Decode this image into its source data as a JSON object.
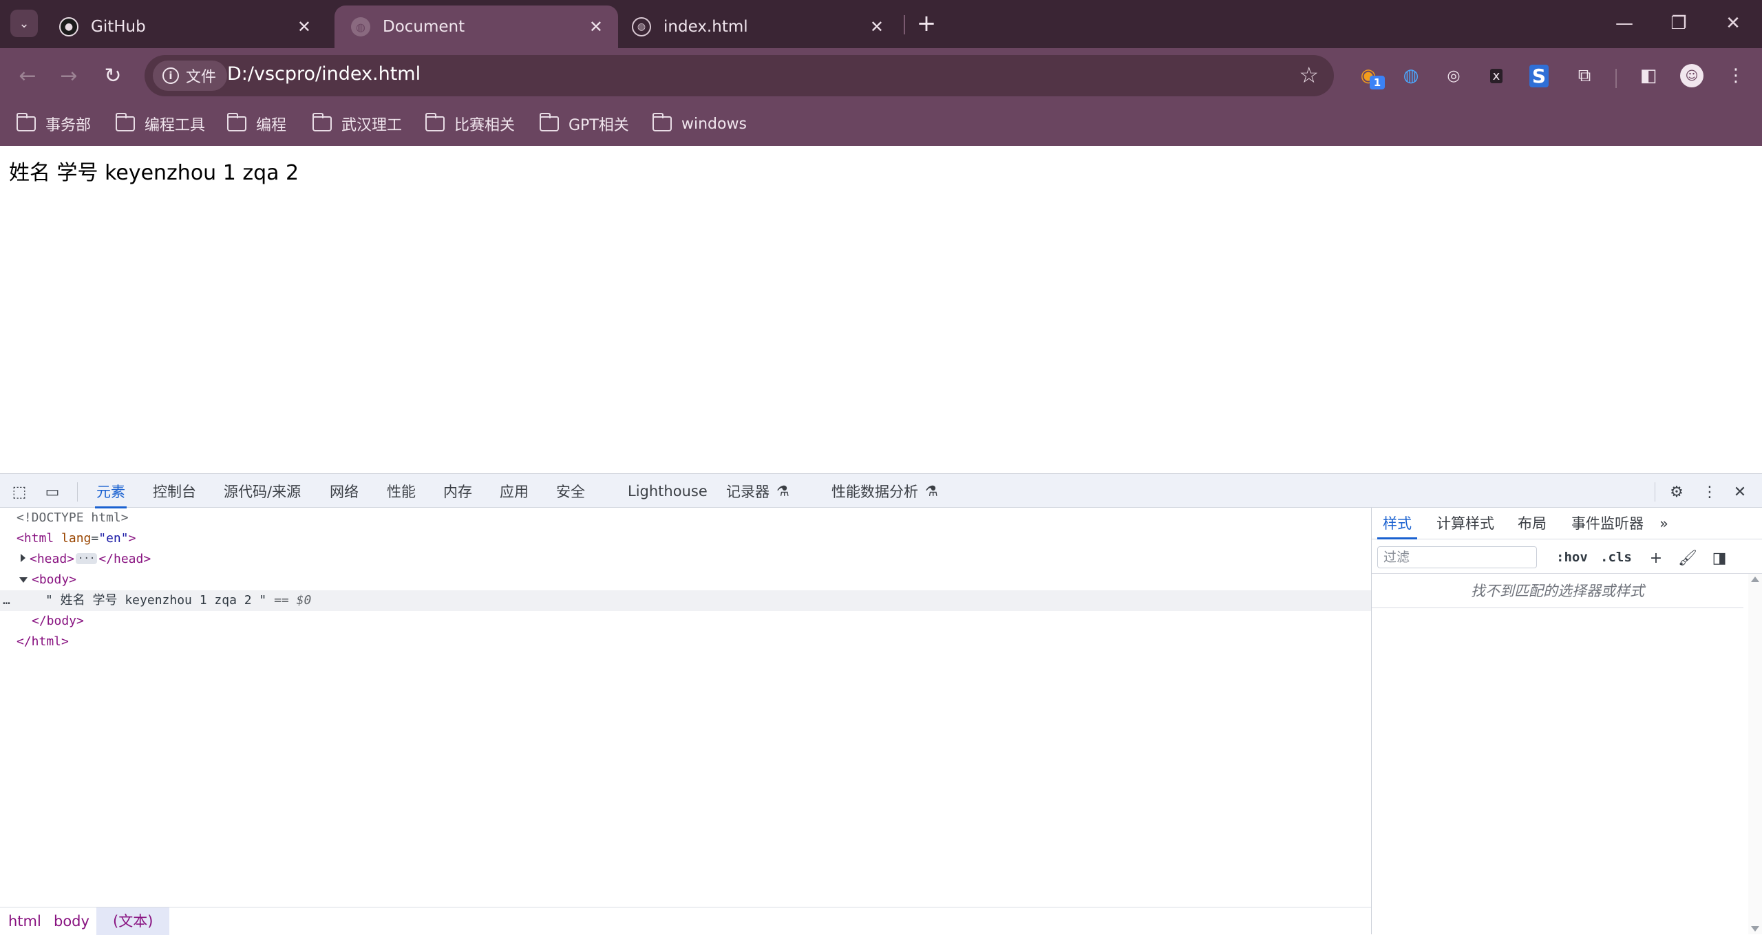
{
  "tabs": [
    {
      "title": "GitHub",
      "favicon": "github-icon",
      "active": false
    },
    {
      "title": "Document",
      "favicon": "globe-icon",
      "active": true
    },
    {
      "title": "index.html",
      "favicon": "globe-icon",
      "active": false
    }
  ],
  "toolbar": {
    "site_chip_label": "文件",
    "url": "D:/vscpro/index.html",
    "extension_badge": "1"
  },
  "bookmarks": [
    "事务部",
    "编程工具",
    "编程",
    "武汉理工",
    "比赛相关",
    "GPT相关",
    "windows"
  ],
  "page": {
    "text": "姓名 学号 keyenzhou 1 zqa 2"
  },
  "devtools": {
    "tabs": [
      "元素",
      "控制台",
      "源代码/来源",
      "网络",
      "性能",
      "内存",
      "应用",
      "安全",
      "Lighthouse",
      "记录器",
      "性能数据分析"
    ],
    "active_tab": "元素",
    "dom": {
      "doctype": "<!DOCTYPE html>",
      "html_open": "<html",
      "lang_attr": "lang",
      "lang_val": "\"en\"",
      "head_open": "<head>",
      "head_close": "</head>",
      "body_open": "<body>",
      "text_node": "\" 姓名 学号 keyenzhou 1 zqa 2 \"",
      "selected_marker": "== $0",
      "body_close": "</body>",
      "html_close": "</html>",
      "gutter_dots": "…"
    },
    "breadcrumb": [
      "html",
      "body",
      "(文本)"
    ],
    "styles": {
      "tabs": [
        "样式",
        "计算样式",
        "布局",
        "事件监听器"
      ],
      "active_tab": "样式",
      "filter_placeholder": "过滤",
      "hov_label": ":hov",
      "cls_label": ".cls",
      "empty_message": "找不到匹配的选择器或样式"
    }
  },
  "colors": {
    "accent": "#1a61d0",
    "frame": "#6a4560",
    "tabstrip": "#3a2534"
  }
}
